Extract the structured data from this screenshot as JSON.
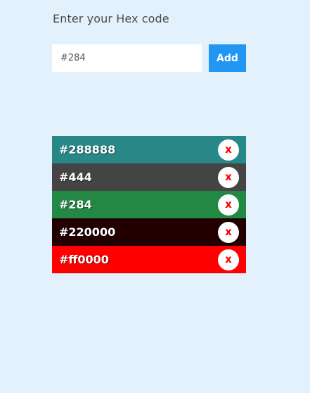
{
  "heading": "Enter your Hex code",
  "input": {
    "value": "#284"
  },
  "add_button_label": "Add",
  "colors": [
    {
      "label": "#288888",
      "color": "#288888",
      "remove_label": "x"
    },
    {
      "label": "#444",
      "color": "#444444",
      "remove_label": "x"
    },
    {
      "label": "#284",
      "color": "#228844",
      "remove_label": "x"
    },
    {
      "label": "#220000",
      "color": "#220000",
      "remove_label": "x"
    },
    {
      "label": "#ff0000",
      "color": "#ff0000",
      "remove_label": "x"
    }
  ]
}
